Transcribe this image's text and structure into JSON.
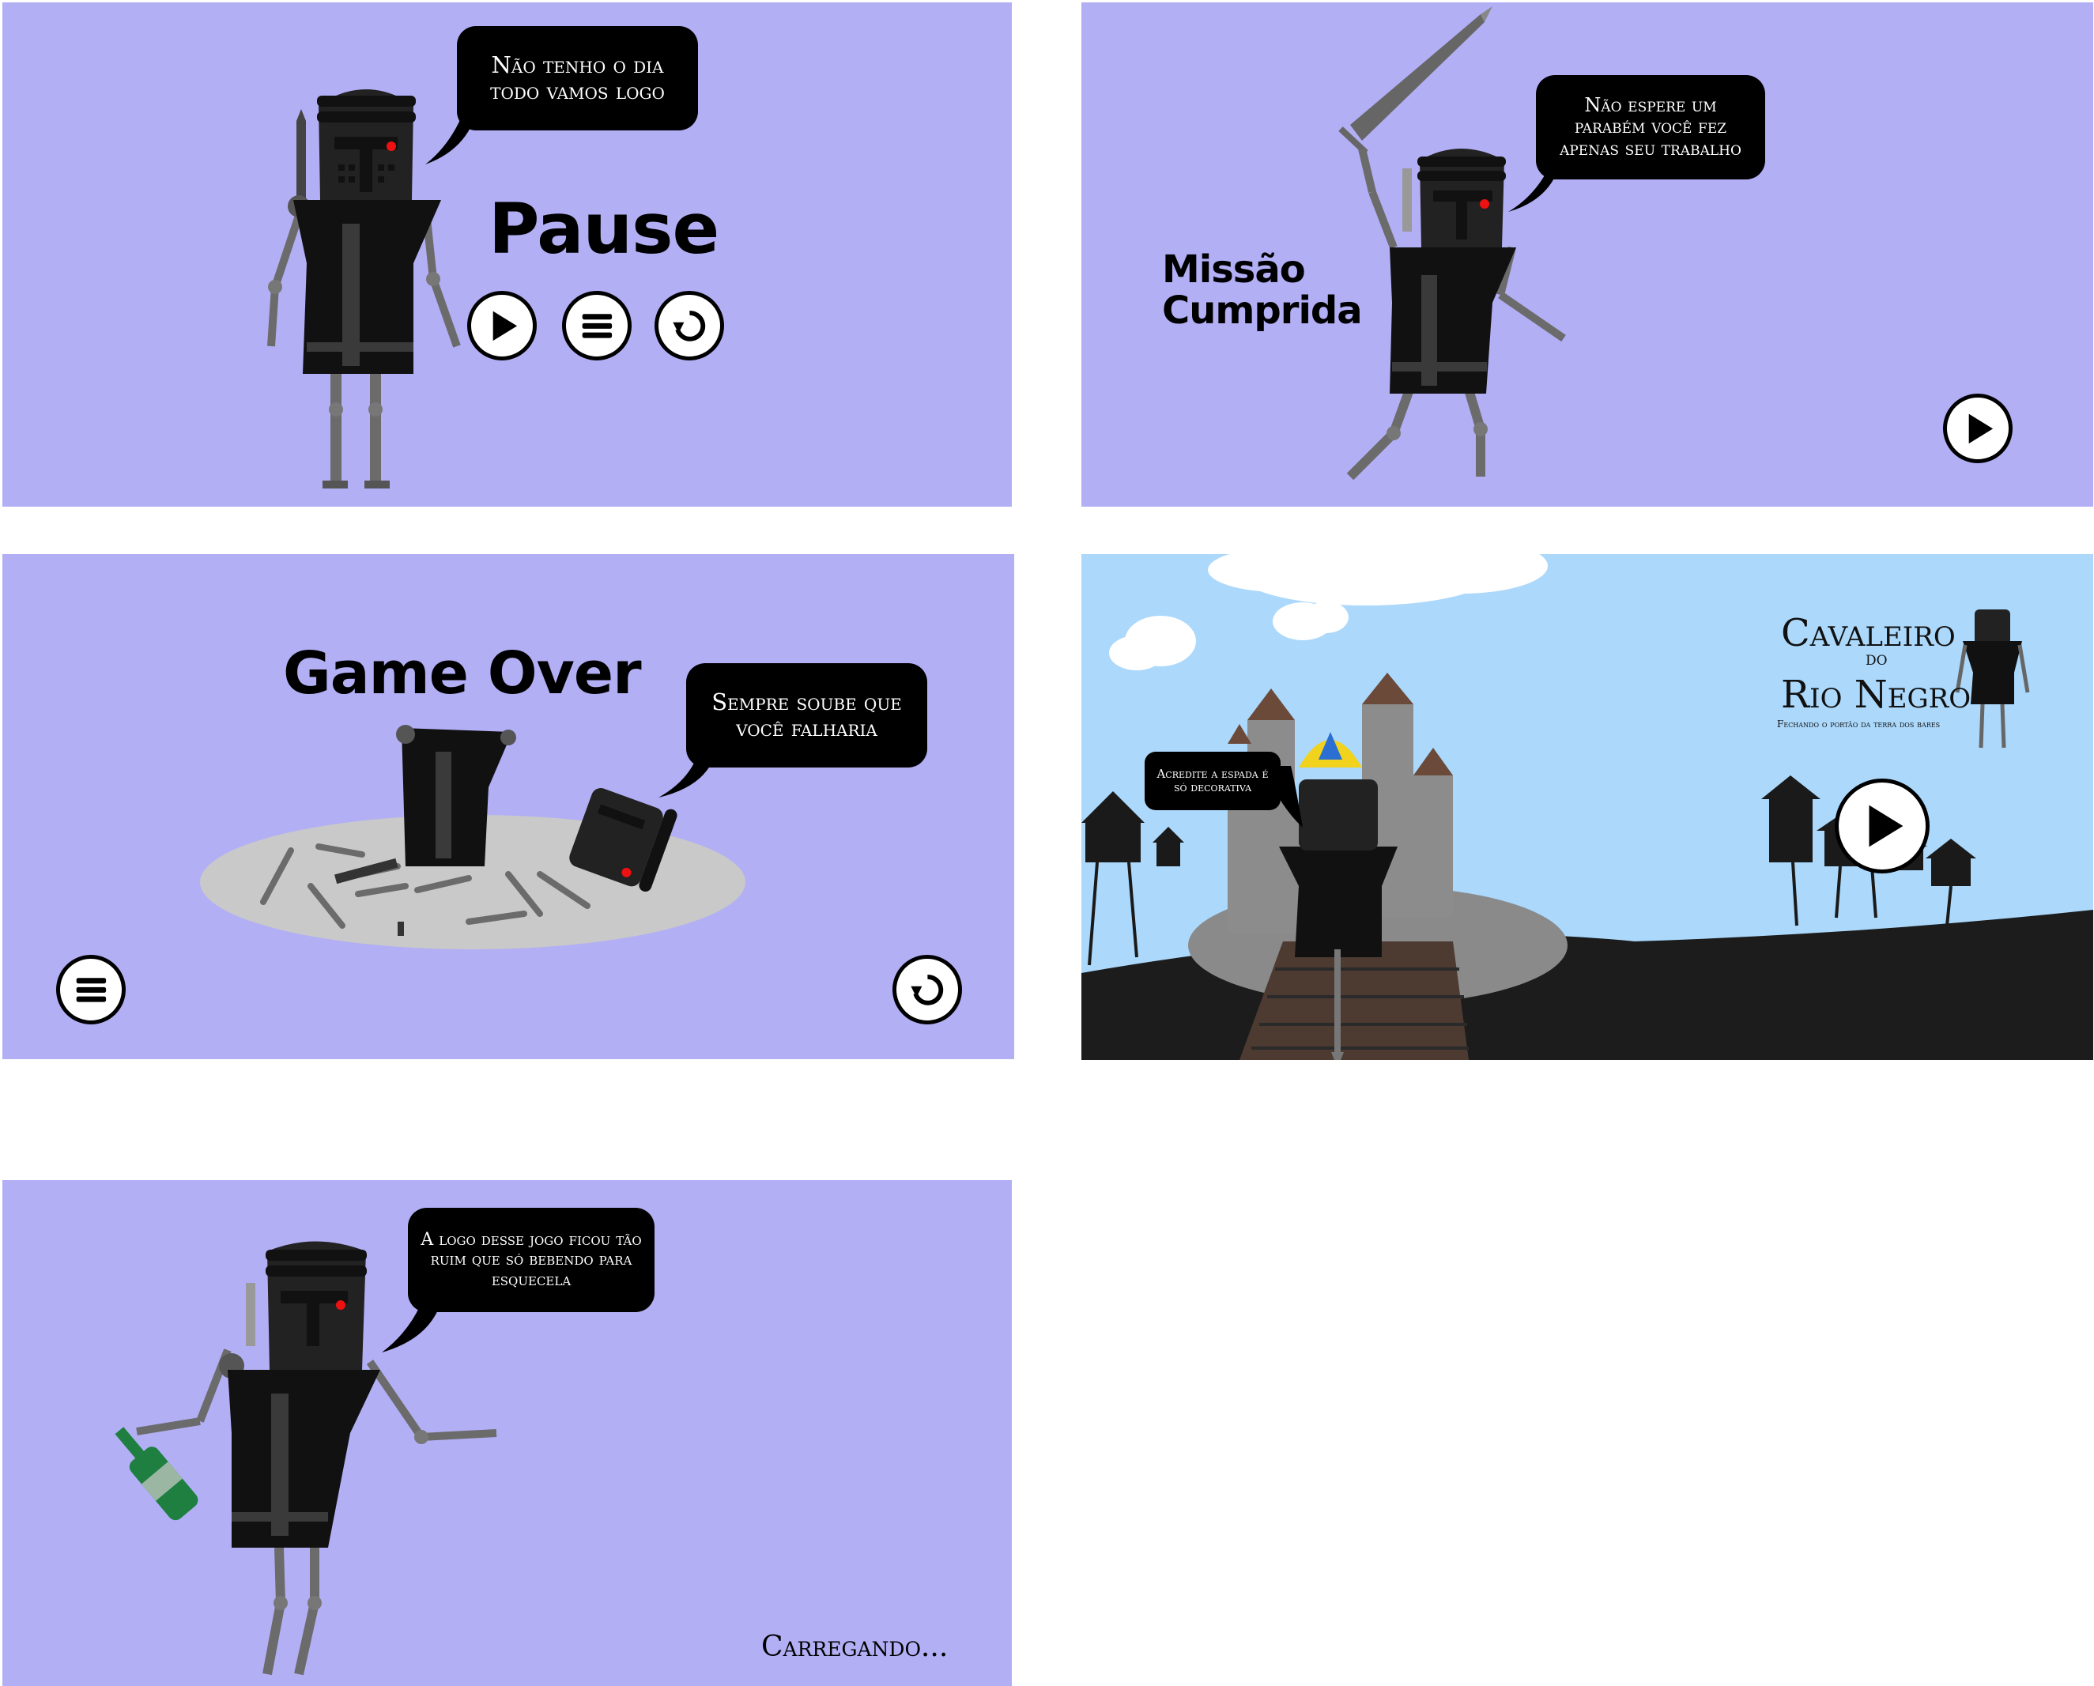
{
  "pause_screen": {
    "speech": "Não tenho o dia todo vamos logo",
    "title": "Pause",
    "buttons": {
      "play": "play-icon",
      "menu": "menu-icon",
      "restart": "restart-icon"
    }
  },
  "mission_screen": {
    "speech": "Não espere um parabém você fez apenas seu trabalho",
    "title_line1": "Missão",
    "title_line2": "Cumprida",
    "buttons": {
      "next": "play-icon"
    }
  },
  "gameover_screen": {
    "title": "Game Over",
    "speech": "Sempre soube que você falharia",
    "buttons": {
      "menu": "menu-icon",
      "restart": "restart-icon"
    }
  },
  "title_screen": {
    "game_title_line1": "Cavaleiro",
    "game_title_line2": "do",
    "game_title_line3": "Rio Negro",
    "subtitle": "Fechando o portão da terra dos bares",
    "speech": "Acredite a espada é só decorativa",
    "buttons": {
      "play": "play-icon"
    }
  },
  "loading_screen": {
    "speech": "A logo desse jogo ficou tão ruim que só bebendo para esquecela",
    "loading_text": "Carregando..."
  },
  "colors": {
    "panel_bg": "#b2aff5",
    "sky": "#abd8fb",
    "knight_dark": "#1b1b1b",
    "armor_grey": "#4a4a4a",
    "bubble": "#000000"
  }
}
